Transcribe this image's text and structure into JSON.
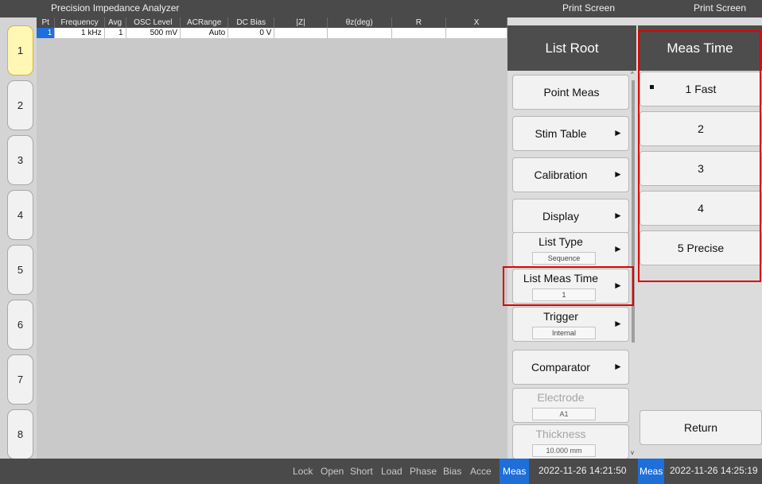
{
  "window": {
    "title": "Precision Impedance Analyzer",
    "print_screen_1": "Print Screen",
    "print_screen_2": "Print Screen"
  },
  "channel_tabs": [
    "1",
    "2",
    "3",
    "4",
    "5",
    "6",
    "7",
    "8"
  ],
  "active_tab": "1",
  "table": {
    "headers": [
      "Pt",
      "Frequency",
      "Avg",
      "OSC Level",
      "ACRange",
      "DC Bias",
      "|Z|",
      "θz(deg)",
      "R",
      "X"
    ],
    "rows": [
      [
        "1",
        "1 kHz",
        "1",
        "500 mV",
        "Auto",
        "0 V",
        "",
        "",
        "",
        ""
      ]
    ]
  },
  "menu": {
    "title": "List Root",
    "items": [
      {
        "label": "Point Meas",
        "value": "",
        "submenu": false,
        "enabled": true
      },
      {
        "label": "Stim Table",
        "value": "",
        "submenu": true,
        "enabled": true
      },
      {
        "label": "Calibration",
        "value": "",
        "submenu": true,
        "enabled": true
      },
      {
        "label": "Display",
        "value": "",
        "submenu": true,
        "enabled": true
      },
      {
        "label": "List Type",
        "value": "Sequence",
        "submenu": true,
        "enabled": true
      },
      {
        "label": "List Meas Time",
        "value": "1",
        "submenu": true,
        "enabled": true
      },
      {
        "label": "Trigger",
        "value": "Internal",
        "submenu": true,
        "enabled": true
      },
      {
        "label": "Comparator",
        "value": "",
        "submenu": true,
        "enabled": true
      },
      {
        "label": "Electrode",
        "value": "A1",
        "submenu": false,
        "enabled": false
      },
      {
        "label": "Thickness",
        "value": "10.000 mm",
        "submenu": false,
        "enabled": false
      }
    ],
    "arrow_glyph": "►",
    "scroll_up": "^",
    "scroll_down": "v"
  },
  "submenu": {
    "title": "Meas Time",
    "options": [
      "1 Fast",
      "2",
      "3",
      "4",
      "5 Precise"
    ],
    "selected": "1 Fast",
    "return_label": "Return"
  },
  "status": {
    "items": [
      "Lock",
      "Open",
      "Short",
      "Load",
      "Phase",
      "Bias",
      "Acce",
      "Meas"
    ],
    "active": "Meas",
    "time1": "2022-11-26 14:21:50",
    "meas2": "Meas",
    "time2": "2022-11-26 14:25:19"
  },
  "colors": {
    "highlight_red": "#e00000",
    "active_blue": "#1e6fd9",
    "active_tab_yellow": "#fff7b3",
    "header_dark": "#4d4d4d"
  }
}
